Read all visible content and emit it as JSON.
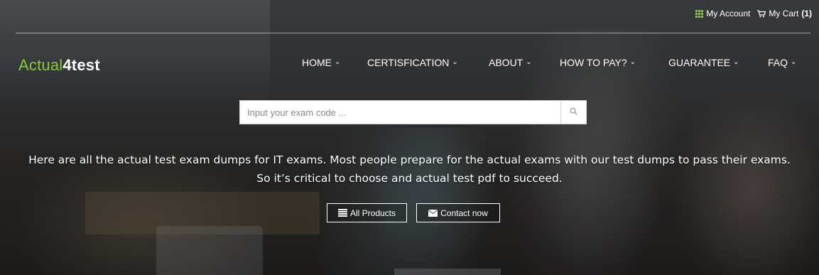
{
  "topbar": {
    "my_account": "My Account",
    "my_cart": "My Cart",
    "cart_count": "(1)",
    "icons": [
      "grid-icon",
      "cart-icon"
    ]
  },
  "brand": {
    "logo_part1": "Actual",
    "logo_part2": "4test",
    "accent_color": "#8cc63f"
  },
  "nav": {
    "items": [
      {
        "label": "HOME"
      },
      {
        "label": "CERTISFICATION"
      },
      {
        "label": "ABOUT"
      },
      {
        "label": "HOW TO PAY?"
      },
      {
        "label": "GUARANTEE"
      },
      {
        "label": "FAQ"
      }
    ],
    "dropdown_icon": "chevron-down-icon"
  },
  "search": {
    "placeholder": "Input your exam code ...",
    "icon": "search-icon"
  },
  "hero": {
    "text": "Here are all the actual test exam dumps for IT exams. Most people prepare for the actual exams with our test dumps to pass their exams. So it’s critical to choose and actual test pdf to succeed."
  },
  "buttons": {
    "all_products": "All Products",
    "contact_now": "Contact now"
  }
}
